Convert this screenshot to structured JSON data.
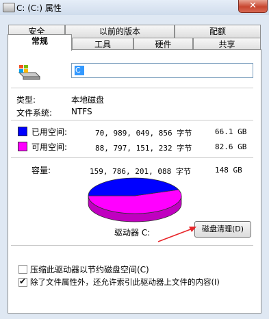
{
  "window": {
    "title": "C: (C:) 属性",
    "close_label": "✕"
  },
  "tabs": {
    "row1": [
      "安全",
      "以前的版本",
      "配额"
    ],
    "row2": [
      "常规",
      "工具",
      "硬件",
      "共享"
    ],
    "active": "常规"
  },
  "drive": {
    "name_value": "C",
    "icon": "drive-icon"
  },
  "info": {
    "type_label": "类型:",
    "type_value": "本地磁盘",
    "fs_label": "文件系统:",
    "fs_value": "NTFS"
  },
  "space": {
    "used": {
      "label": "已用空间:",
      "bytes": "70, 989, 049, 856 字节",
      "gb": "66.1 GB",
      "color": "#0000ff"
    },
    "free": {
      "label": "可用空间:",
      "bytes": "88, 797, 151, 232 字节",
      "gb": "82.6 GB",
      "color": "#ff00ff"
    },
    "capacity": {
      "label": "容量:",
      "bytes": "159, 786, 201, 088 字节",
      "gb": "148 GB"
    }
  },
  "pie": {
    "used_fraction": 0.444,
    "drive_label": "驱动器 C:"
  },
  "cleanup_button": "磁盘清理(D)",
  "options": {
    "compress": {
      "label": "压缩此驱动器以节约磁盘空间(C)",
      "checked": false
    },
    "index": {
      "label": "除了文件属性外，还允许索引此驱动器上文件的内容(I)",
      "checked": true
    }
  }
}
